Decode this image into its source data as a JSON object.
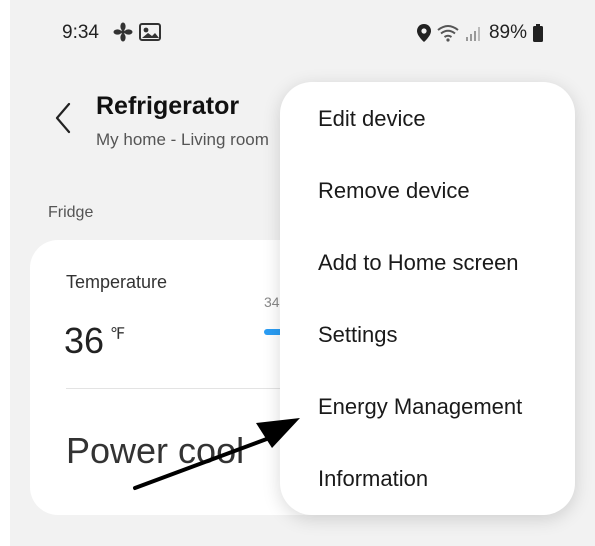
{
  "status_bar": {
    "time": "9:34",
    "left_icons": [
      "fan-icon",
      "gallery-icon"
    ],
    "right_icons": [
      "location-icon",
      "wifi-icon",
      "signal-icon"
    ],
    "battery_percent": "89%"
  },
  "header": {
    "back_icon": "back-chevron-icon",
    "title": "Refrigerator",
    "subtitle": "My home - Living room"
  },
  "section_label": "Fridge",
  "card": {
    "temperature_label": "Temperature",
    "temperature_value": "36",
    "temperature_unit": "℉",
    "range_min_label": "34",
    "power_cool_label": "Power cool",
    "slider_color": "#2a9df4"
  },
  "menu": {
    "items": [
      {
        "label": "Edit device"
      },
      {
        "label": "Remove device"
      },
      {
        "label": "Add to Home screen"
      },
      {
        "label": "Settings"
      },
      {
        "label": "Energy Management"
      },
      {
        "label": "Information"
      }
    ]
  },
  "annotation": {
    "type": "arrow",
    "color": "#000000",
    "points_to": "Energy Management"
  }
}
